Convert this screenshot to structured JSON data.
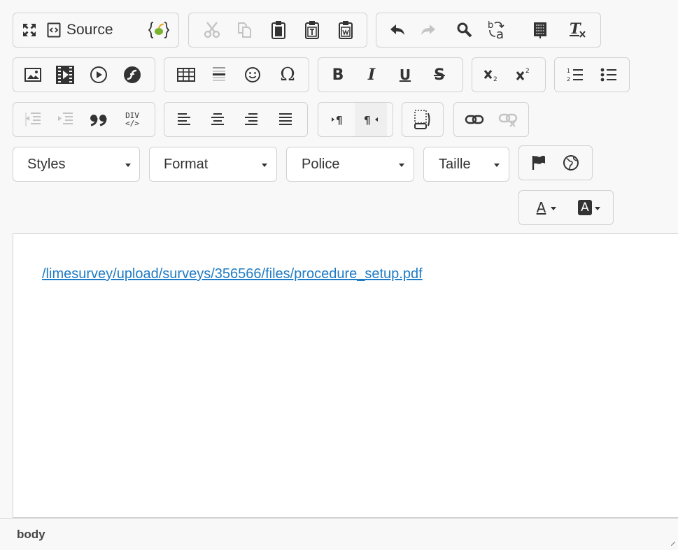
{
  "toolbar": {
    "source_label": "Source",
    "styles_label": "Styles",
    "format_label": "Format",
    "font_label": "Police",
    "size_label": "Taille",
    "bold_glyph": "B",
    "italic_glyph": "I",
    "underline_glyph": "U",
    "strike_glyph": "S",
    "omega_glyph": "Ω",
    "div_glyph_top": "DIV",
    "div_glyph_bottom": "</>",
    "text_color_glyph": "A",
    "bg_color_glyph": "A",
    "icons": {
      "row1": [
        "maximize-icon",
        "source-icon",
        "code-snippet-icon",
        "cut-icon",
        "copy-icon",
        "paste-icon",
        "paste-text-icon",
        "paste-word-icon",
        "undo-icon",
        "redo-icon",
        "find-icon",
        "replace-icon",
        "select-all-icon",
        "remove-format-icon"
      ],
      "row2": [
        "image-icon",
        "video-icon",
        "media-play-icon",
        "flash-icon",
        "table-icon",
        "horizontal-rule-icon",
        "smiley-icon",
        "special-char-icon",
        "bold-icon",
        "italic-icon",
        "underline-icon",
        "strike-icon",
        "subscript-icon",
        "superscript-icon",
        "numbered-list-icon",
        "bulleted-list-icon"
      ],
      "row3": [
        "outdent-icon",
        "indent-icon",
        "blockquote-icon",
        "div-icon",
        "align-left-icon",
        "align-center-icon",
        "align-right-icon",
        "justify-icon",
        "ltr-icon",
        "rtl-icon",
        "show-blocks-icon",
        "link-icon",
        "unlink-icon"
      ],
      "row4": [
        "anchor-flag-icon",
        "globe-language-icon",
        "text-color-icon",
        "background-color-icon"
      ]
    },
    "colors": {
      "link": "#1f7bc4",
      "border": "#d1d1d1",
      "toolbar_bg": "#f8f8f8",
      "disabled": "#c4c4c4"
    }
  },
  "content": {
    "link_text": "/limesurvey/upload/surveys/356566/files/procedure_setup.pdf"
  },
  "statusbar": {
    "path": "body"
  }
}
